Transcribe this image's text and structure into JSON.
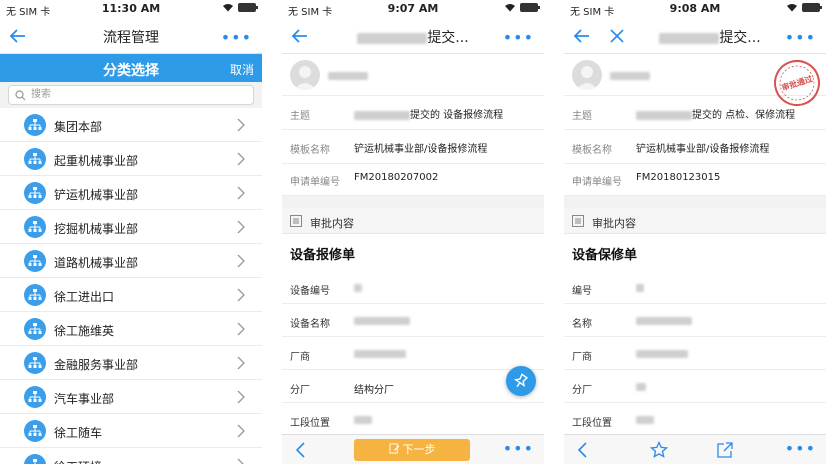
{
  "statusbar": {
    "carrier": "无 SIM 卡",
    "times": [
      "11:30 AM",
      "9:07 AM",
      "9:08 AM"
    ]
  },
  "screen1": {
    "nav_title": "流程管理",
    "nav_more": "•••",
    "category_title": "分类选择",
    "cancel": "取消",
    "search_placeholder": "搜索",
    "items": [
      "集团本部",
      "起重机械事业部",
      "铲运机械事业部",
      "挖掘机械事业部",
      "道路机械事业部",
      "徐工进出口",
      "徐工施维英",
      "金融服务事业部",
      "汽车事业部",
      "徐工随车",
      "徐工环境"
    ]
  },
  "screen2": {
    "nav_title_suffix": "提交...",
    "subject_label": "主题",
    "subject_suffix": "提交的 设备报修流程",
    "template_label": "模板名称",
    "template_value": "铲运机械事业部/设备报修流程",
    "request_label": "申请单编号",
    "request_value": "FM20180207002",
    "section_title": "审批内容",
    "form_title": "设备报修单",
    "rows": [
      {
        "label": "设备编号",
        "value": ""
      },
      {
        "label": "设备名称",
        "value": ""
      },
      {
        "label": "厂商",
        "value": ""
      },
      {
        "label": "分厂",
        "value": "结构分厂"
      },
      {
        "label": "工段位置",
        "value": ""
      }
    ],
    "next_label": "下一步"
  },
  "screen3": {
    "nav_title_suffix": "提交...",
    "subject_label": "主题",
    "subject_suffix": "提交的 点检、保修流程",
    "template_label": "模板名称",
    "template_value": "铲运机械事业部/设备报修流程",
    "request_label": "申请单编号",
    "request_value": "FM20180123015",
    "stamp_text": "审批通过",
    "section_title": "审批内容",
    "form_title": "设备保修单",
    "rows": [
      {
        "label": "编号",
        "value": ""
      },
      {
        "label": "名称",
        "value": ""
      },
      {
        "label": "厂商",
        "value": ""
      },
      {
        "label": "分厂",
        "value": ""
      },
      {
        "label": "工段位置",
        "value": ""
      }
    ]
  },
  "colors": {
    "accent": "#2e9be8",
    "next_button": "#f5b342",
    "stamp": "#d9534f"
  }
}
